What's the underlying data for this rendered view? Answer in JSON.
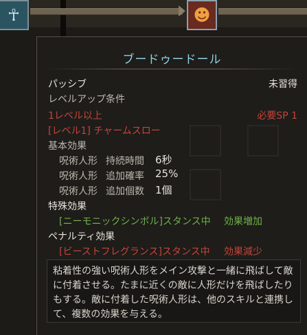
{
  "tree": {
    "icons": [
      {
        "name": "left-skill",
        "glyph": "☥",
        "color": "#2a5560"
      },
      {
        "name": "current-skill",
        "glyph": "☻",
        "color": "#6a2a20"
      }
    ]
  },
  "tooltip": {
    "title": "ブードゥードール",
    "type": "パッシブ",
    "status": "未習得",
    "levelup_header": "レベルアップ条件",
    "req_level": "1レベル以上",
    "req_sp": "必要SP 1",
    "req_skill": "[レベル1] チャームスロー",
    "base_header": "基本効果",
    "base_effects": [
      {
        "target": "呪術人形",
        "label": "持続時間",
        "value": "6秒"
      },
      {
        "target": "呪術人形",
        "label": "追加確率",
        "value": "25%"
      },
      {
        "target": "呪術人形",
        "label": "追加個数",
        "value": "1個"
      }
    ],
    "special_header": "特殊効果",
    "special_condition": "[ニーモニックシンボル]スタンス中",
    "special_effect": "効果増加",
    "penalty_header": "ペナルティ効果",
    "penalty_condition": "[ビーストフレグランス]スタンス中",
    "penalty_effect": "効果減少",
    "description": "粘着性の強い呪術人形をメイン攻撃と一緒に飛ばして敵に付着させる。たまに近くの敵に人形だけを飛ばしたりもする。敵に付着した呪術人形は、他のスキルと連携して、複数の効果を与える。"
  }
}
